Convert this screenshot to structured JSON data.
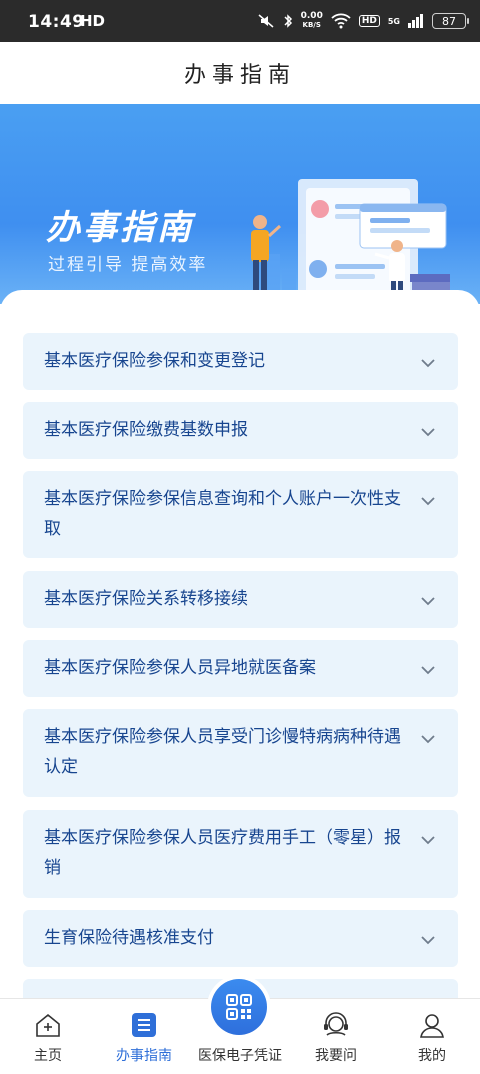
{
  "status_bar": {
    "time": "14:49",
    "hd": "HD",
    "net_speed_top": "0.00",
    "net_speed_unit": "KB/S",
    "hd_badge": "HD",
    "signal": "5G",
    "battery": "87"
  },
  "header": {
    "title": "办事指南"
  },
  "banner": {
    "title": "办事指南",
    "subtitle": "过程引导  提高效率"
  },
  "items": [
    {
      "label": "基本医疗保险参保和变更登记"
    },
    {
      "label": "基本医疗保险缴费基数申报"
    },
    {
      "label": "基本医疗保险参保信息查询和个人账户一次性支取"
    },
    {
      "label": "基本医疗保险关系转移接续"
    },
    {
      "label": "基本医疗保险参保人员异地就医备案"
    },
    {
      "label": "基本医疗保险参保人员享受门诊慢特病病种待遇认定"
    },
    {
      "label": "基本医疗保险参保人员医疗费用手工（零星）报销"
    },
    {
      "label": "生育保险待遇核准支付"
    }
  ],
  "tabs": [
    {
      "label": "主页",
      "icon": "home-icon"
    },
    {
      "label": "办事指南",
      "icon": "guide-icon",
      "active": true
    },
    {
      "label": "医保电子凭证",
      "icon": "qr-code-icon"
    },
    {
      "label": "我要问",
      "icon": "headset-icon"
    },
    {
      "label": "我的",
      "icon": "user-icon"
    }
  ],
  "colors": {
    "accent": "#2f6fd8",
    "item_bg": "#eaf4fc",
    "item_text": "#17458f",
    "banner": "#3f8ff0"
  }
}
